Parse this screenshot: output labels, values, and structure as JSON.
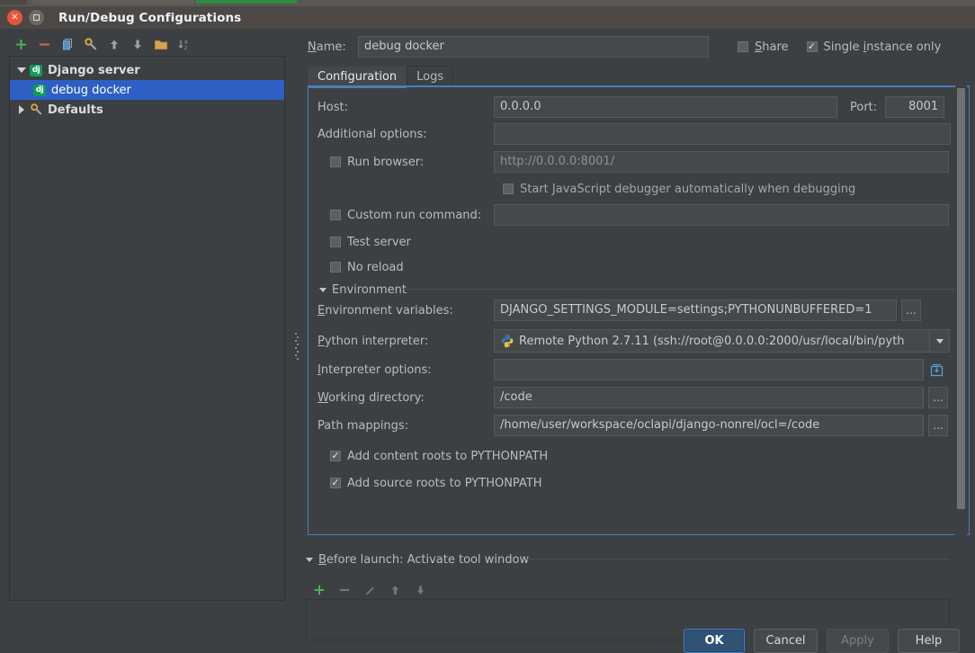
{
  "window": {
    "title": "Run/Debug Configurations",
    "close_icon": "close-icon",
    "maximize_icon": "maximize-icon"
  },
  "tree_toolbar": [
    {
      "name": "add-icon",
      "glyph": "+",
      "color": "#4caf50"
    },
    {
      "name": "remove-icon",
      "glyph": "−",
      "color": "#d0654f"
    },
    {
      "name": "copy-icon",
      "glyph": "copy",
      "color": "#6badd6"
    },
    {
      "name": "settings-icon",
      "glyph": "wrench",
      "color": "#d8a33a"
    },
    {
      "name": "move-up-icon",
      "glyph": "↑",
      "color": "#9aa0a3"
    },
    {
      "name": "move-down-icon",
      "glyph": "↓",
      "color": "#9aa0a3"
    },
    {
      "name": "folder-icon",
      "glyph": "folder",
      "color": "#d5a351"
    },
    {
      "name": "sort-alpha-icon",
      "glyph": "sort",
      "color": "#9aa0a3"
    }
  ],
  "tree": {
    "items": [
      {
        "label": "Django server",
        "expander": "down",
        "icon": "django-icon",
        "indent": 0,
        "selected": false,
        "bold": true
      },
      {
        "label": "debug docker",
        "expander": "none",
        "icon": "django-icon",
        "indent": 1,
        "selected": true,
        "bold": false
      },
      {
        "label": "Defaults",
        "expander": "right",
        "icon": "defaults-icon",
        "indent": 0,
        "selected": false,
        "bold": true
      }
    ]
  },
  "name_row": {
    "label": "Name:",
    "label_mnemonic": "N",
    "value": "debug docker",
    "share": {
      "label": "Share",
      "mnemonic": "S",
      "checked": false
    },
    "single_instance": {
      "label": "Single instance only",
      "mnemonic": "i",
      "checked": true
    }
  },
  "tabs": [
    {
      "label": "Configuration",
      "active": true
    },
    {
      "label": "Logs",
      "active": false
    }
  ],
  "form": {
    "host": {
      "label": "Host:",
      "value": "0.0.0.0"
    },
    "port": {
      "label": "Port:",
      "value": "8001"
    },
    "additional_options": {
      "label": "Additional options:",
      "value": ""
    },
    "run_browser": {
      "label": "Run browser:",
      "checked": false,
      "value": "http://0.0.0.0:8001/",
      "is_placeholder": true
    },
    "start_js_debugger": {
      "label": "Start JavaScript debugger automatically when debugging",
      "checked": false
    },
    "custom_run_command": {
      "label": "Custom run command:",
      "checked": false,
      "value": ""
    },
    "test_server": {
      "label": "Test server",
      "checked": false
    },
    "no_reload": {
      "label": "No reload",
      "checked": false
    }
  },
  "environment": {
    "section_title": "Environment",
    "env_vars": {
      "label": "Environment variables:",
      "mnemonic": "E",
      "value": "DJANGO_SETTINGS_MODULE=settings;PYTHONUNBUFFERED=1",
      "button": "..."
    },
    "python_interpreter": {
      "label": "Python interpreter:",
      "mnemonic": "P",
      "value": "Remote Python 2.7.11 (ssh://root@0.0.0.0:2000/usr/local/bin/pyth",
      "icon": "python-icon"
    },
    "interpreter_options": {
      "label": "Interpreter options:",
      "mnemonic": "I",
      "value": "",
      "button_icon": "expand-editor-icon"
    },
    "working_directory": {
      "label": "Working directory:",
      "mnemonic": "W",
      "value": "/code",
      "button": "..."
    },
    "path_mappings": {
      "label": "Path mappings:",
      "value": "/home/user/workspace/oclapi/django-nonrel/ocl=/code",
      "button": "..."
    },
    "add_content_roots": {
      "label": "Add content roots to PYTHONPATH",
      "checked": true
    },
    "add_source_roots": {
      "label": "Add source roots to PYTHONPATH",
      "checked": true
    }
  },
  "before_launch": {
    "section_title": "Before launch: Activate tool window",
    "mnemonic": "B",
    "toolbar": [
      {
        "name": "add-task-icon",
        "glyph": "+",
        "enabled": true
      },
      {
        "name": "remove-task-icon",
        "glyph": "−",
        "enabled": false
      },
      {
        "name": "edit-task-icon",
        "glyph": "pencil",
        "enabled": false
      },
      {
        "name": "move-task-up-icon",
        "glyph": "↑",
        "enabled": false
      },
      {
        "name": "move-task-down-icon",
        "glyph": "↓",
        "enabled": false
      }
    ],
    "list_items": []
  },
  "buttons": [
    {
      "label": "OK",
      "style": "primary",
      "name": "ok-button"
    },
    {
      "label": "Cancel",
      "style": "normal",
      "name": "cancel-button"
    },
    {
      "label": "Apply",
      "style": "disabled",
      "name": "apply-button"
    },
    {
      "label": "Help",
      "style": "normal",
      "name": "help-button"
    }
  ],
  "colors": {
    "window_bg": "#3c4042",
    "titlebar_bg": "#4b4846",
    "selection_blue": "#2d5fc4",
    "accent_blue": "#4a7ebb",
    "field_bg": "#45494b",
    "text": "#bbbbbb"
  }
}
